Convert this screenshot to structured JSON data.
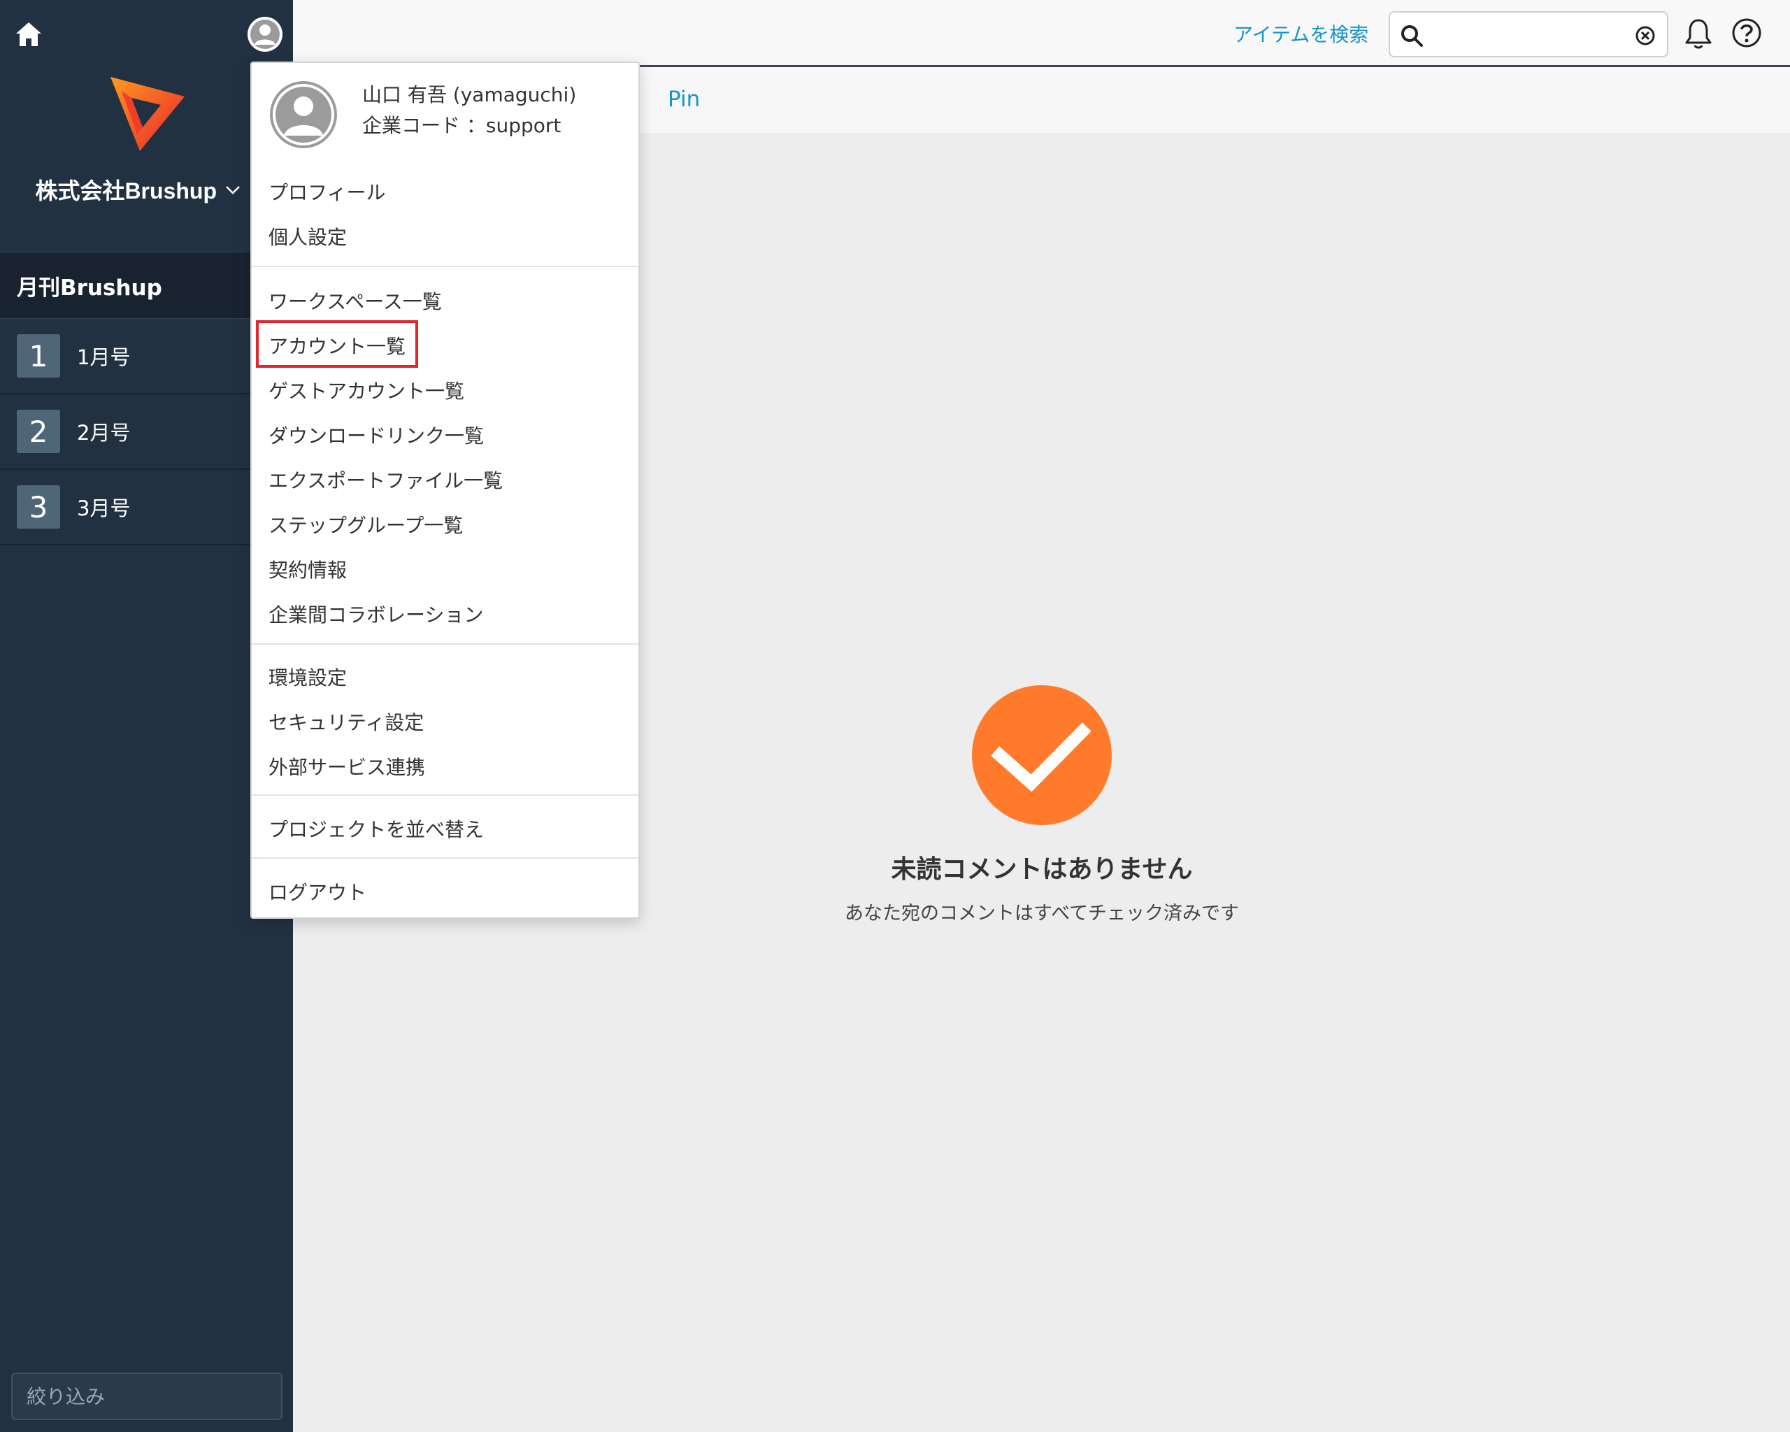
{
  "sidebar": {
    "company_name": "株式会社Brushup",
    "project_title": "月刊Brushup",
    "issues": [
      {
        "number": "1",
        "label": "1月号"
      },
      {
        "number": "2",
        "label": "2月号"
      },
      {
        "number": "3",
        "label": "3月号"
      }
    ],
    "filter_placeholder": "絞り込み"
  },
  "topbar": {
    "search_link": "アイテムを検索",
    "search_value": ""
  },
  "tabs": {
    "pin_label": "Pin"
  },
  "menu": {
    "user_name": "山口 有吾 (yamaguchi)",
    "company_code": "企業コード ：support",
    "sections": [
      [
        "プロフィール",
        "個人設定"
      ],
      [
        "ワークスペース一覧",
        "アカウント一覧",
        "ゲストアカウント一覧",
        "ダウンロードリンク一覧",
        "エクスポートファイル一覧",
        "ステップグループ一覧",
        "契約情報",
        "企業間コラボレーション"
      ],
      [
        "環境設定",
        "セキュリティ設定",
        "外部サービス連携"
      ],
      [
        "プロジェクトを並べ替え"
      ],
      [
        "ログアウト"
      ]
    ],
    "highlighted_item": "アカウント一覧"
  },
  "empty_state": {
    "title": "未読コメントはありません",
    "subtitle": "あなた宛のコメントはすべてチェック済みです"
  },
  "colors": {
    "sidebar_bg": "#223142",
    "accent_blue": "#1795c9",
    "check_orange": "#ff7a2b",
    "highlight_red": "#e0272d"
  },
  "icons": [
    "home-icon",
    "user-avatar-icon",
    "brushup-logo-icon",
    "chevron-down-icon",
    "search-icon",
    "clear-icon",
    "bell-icon",
    "help-icon",
    "checkmark-icon"
  ]
}
